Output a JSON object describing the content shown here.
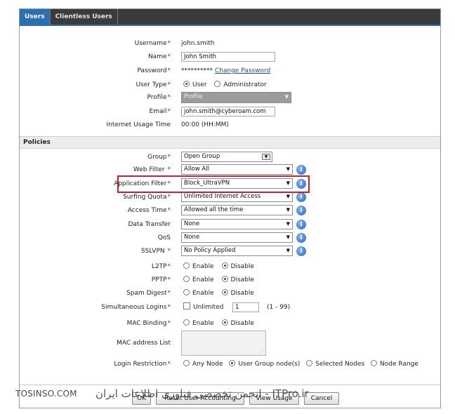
{
  "tabs": [
    {
      "label": "Users",
      "active": true
    },
    {
      "label": "Clientless Users",
      "active": false
    }
  ],
  "user": {
    "username_label": "Username",
    "username_value": "john.smith",
    "name_label": "Name",
    "name_value": "John Smith",
    "password_label": "Password",
    "password_mask": "**********",
    "password_link": "Change Password",
    "usertype_label": "User Type",
    "usertype_options": [
      "User",
      "Administrator"
    ],
    "usertype_selected": "User",
    "profile_label": "Profile",
    "profile_value": "Profile",
    "email_label": "Email",
    "email_value": "john.smith@cyberoam.com",
    "usage_label": "Internet Usage Time",
    "usage_value": "00:00 (HH:MM)"
  },
  "policies": {
    "section_title": "Policies",
    "group_label": "Group",
    "group_value": "Open Group",
    "web_filter_label": "Web Filter",
    "web_filter_value": "Allow All",
    "app_filter_label": "Application Filter",
    "app_filter_value": "Block_UltraVPN",
    "surfing_label": "Surfing Quota",
    "surfing_value": "Unlimited Internet Access",
    "access_label": "Access Time",
    "access_value": "Allowed all the time",
    "transfer_label": "Data Transfer",
    "transfer_value": "None",
    "qos_label": "QoS",
    "qos_value": "None",
    "sslvpn_label": "SSLVPN",
    "sslvpn_value": "No Policy Applied",
    "l2tp_label": "L2TP",
    "pptp_label": "PPTP",
    "spam_label": "Spam Digest",
    "enable_label": "Enable",
    "disable_label": "Disable",
    "l2tp_selected": "Disable",
    "pptp_selected": "Disable",
    "spam_selected": "Disable",
    "logins_label": "Simultaneous Logins",
    "logins_unlimited_label": "Unlimited",
    "logins_unlimited_checked": false,
    "logins_value": "1",
    "logins_range": "(1 - 99)",
    "mac_binding_label": "MAC Binding",
    "mac_binding_selected": "Disable",
    "mac_list_label": "MAC address List",
    "login_restriction_label": "Login Restriction",
    "login_restriction_options": [
      "Any Node",
      "User Group node(s)",
      "Selected Nodes",
      "Node Range"
    ],
    "login_restriction_selected": "User Group node(s)"
  },
  "buttons": {
    "ok": "OK",
    "reset": "Reset User Accounting",
    "view_usage": "View Usage",
    "cancel": "Cancel"
  },
  "watermark": {
    "left": "TOSINSO.COM",
    "right": "انجمن تخصصی فناوری اطلاعات ایران - ITPro.ir"
  },
  "colors": {
    "tab_active": "#2a6fb2",
    "tab_bar": "#3b3b3b",
    "required": "#cc1f1f",
    "highlight": "#d01f2b",
    "link": "#1d4f95"
  }
}
